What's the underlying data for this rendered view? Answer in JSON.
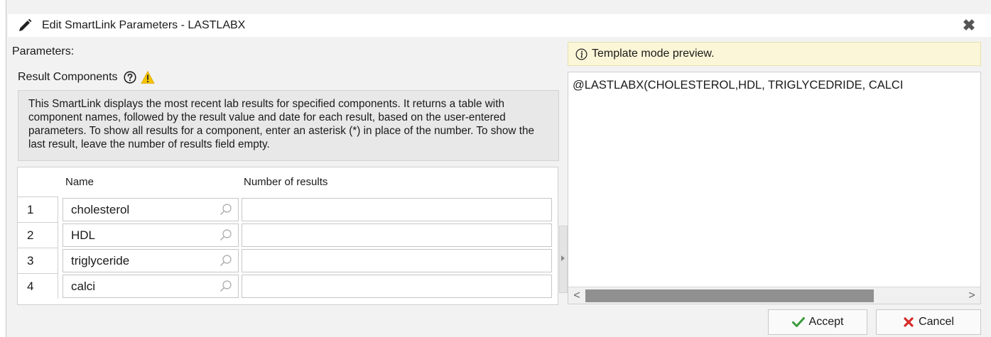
{
  "dialog": {
    "title": "Edit SmartLink Parameters - LASTLABX",
    "title_icon": "pencil-icon",
    "close_icon": "close-icon",
    "close_glyph": "✖"
  },
  "parameters_label": "Parameters:",
  "result_components": {
    "label": "Result Components",
    "help_icon": "help-icon",
    "warning_icon": "warning-icon"
  },
  "description": "This SmartLink displays the most recent lab results for specified components. It returns a table with component names, followed by the result value and date for each result, based on the user-entered parameters. To show all results for a component, enter an asterisk (*) in place of the number. To show the last result, leave the number of results field empty.",
  "table": {
    "columns": [
      "Name",
      "Number of results"
    ],
    "rows": [
      {
        "num": "1",
        "name": "cholesterol",
        "count": ""
      },
      {
        "num": "2",
        "name": "HDL",
        "count": ""
      },
      {
        "num": "3",
        "name": "triglyceride",
        "count": ""
      },
      {
        "num": "4",
        "name": "calci",
        "count": ""
      }
    ]
  },
  "preview": {
    "banner": "Template mode preview.",
    "banner_icon": "info-icon",
    "text": "@LASTLABX(CHOLESTEROL,HDL, TRIGLYCEDRIDE, CALCI",
    "scroll_left": "<",
    "scroll_right": ">"
  },
  "buttons": {
    "accept": "Accept",
    "cancel": "Cancel"
  },
  "colors": {
    "accept_check": "#3a9a3a",
    "cancel_x": "#d62a2a",
    "banner_bg": "#fbf6d7",
    "warning": "#f5c400"
  }
}
